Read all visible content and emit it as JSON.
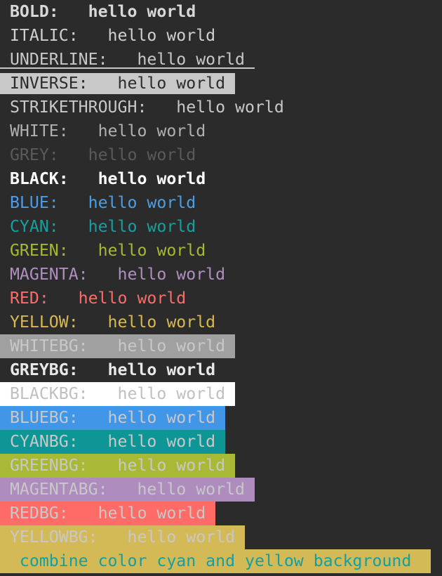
{
  "terminal": {
    "background": "#2b2b2b",
    "lines": [
      {
        "style": "bold",
        "text": " BOLD:   hello world "
      },
      {
        "style": "italic",
        "text": " ITALIC:   hello world "
      },
      {
        "style": "underline",
        "text": " UNDERLINE:   hello world "
      },
      {
        "style": "inverse",
        "text": " INVERSE:   hello world "
      },
      {
        "style": "strike",
        "text": " STRIKETHROUGH:   hello world "
      },
      {
        "style": "white",
        "text": " WHITE:   hello world "
      },
      {
        "style": "grey",
        "text": " GREY:   hello world "
      },
      {
        "style": "black",
        "text": " BLACK:   hello world "
      },
      {
        "style": "blue",
        "text": " BLUE:   hello world "
      },
      {
        "style": "cyan",
        "text": " CYAN:   hello world "
      },
      {
        "style": "green",
        "text": " GREEN:   hello world "
      },
      {
        "style": "magenta",
        "text": " MAGENTA:   hello world "
      },
      {
        "style": "red",
        "text": " RED:   hello world "
      },
      {
        "style": "yellow",
        "text": " YELLOW:   hello world "
      },
      {
        "style": "whitebg",
        "text": " WHITEBG:   hello world "
      },
      {
        "style": "greybg",
        "text": " GREYBG:   hello world "
      },
      {
        "style": "blackbg",
        "text": " BLACKBG:   hello world "
      },
      {
        "style": "bluebg",
        "text": " BLUEBG:   hello world "
      },
      {
        "style": "cyanbg",
        "text": " CYANBG:   hello world "
      },
      {
        "style": "greenbg",
        "text": " GREENBG:   hello world "
      },
      {
        "style": "magentabg",
        "text": " MAGENTABG:   hello world "
      },
      {
        "style": "redbg",
        "text": " REDBG:   hello world "
      },
      {
        "style": "yellowbg",
        "text": " YELLOWBG:   hello world "
      },
      {
        "style": "combine",
        "text": "  combine color cyan and yellow background  "
      }
    ]
  }
}
